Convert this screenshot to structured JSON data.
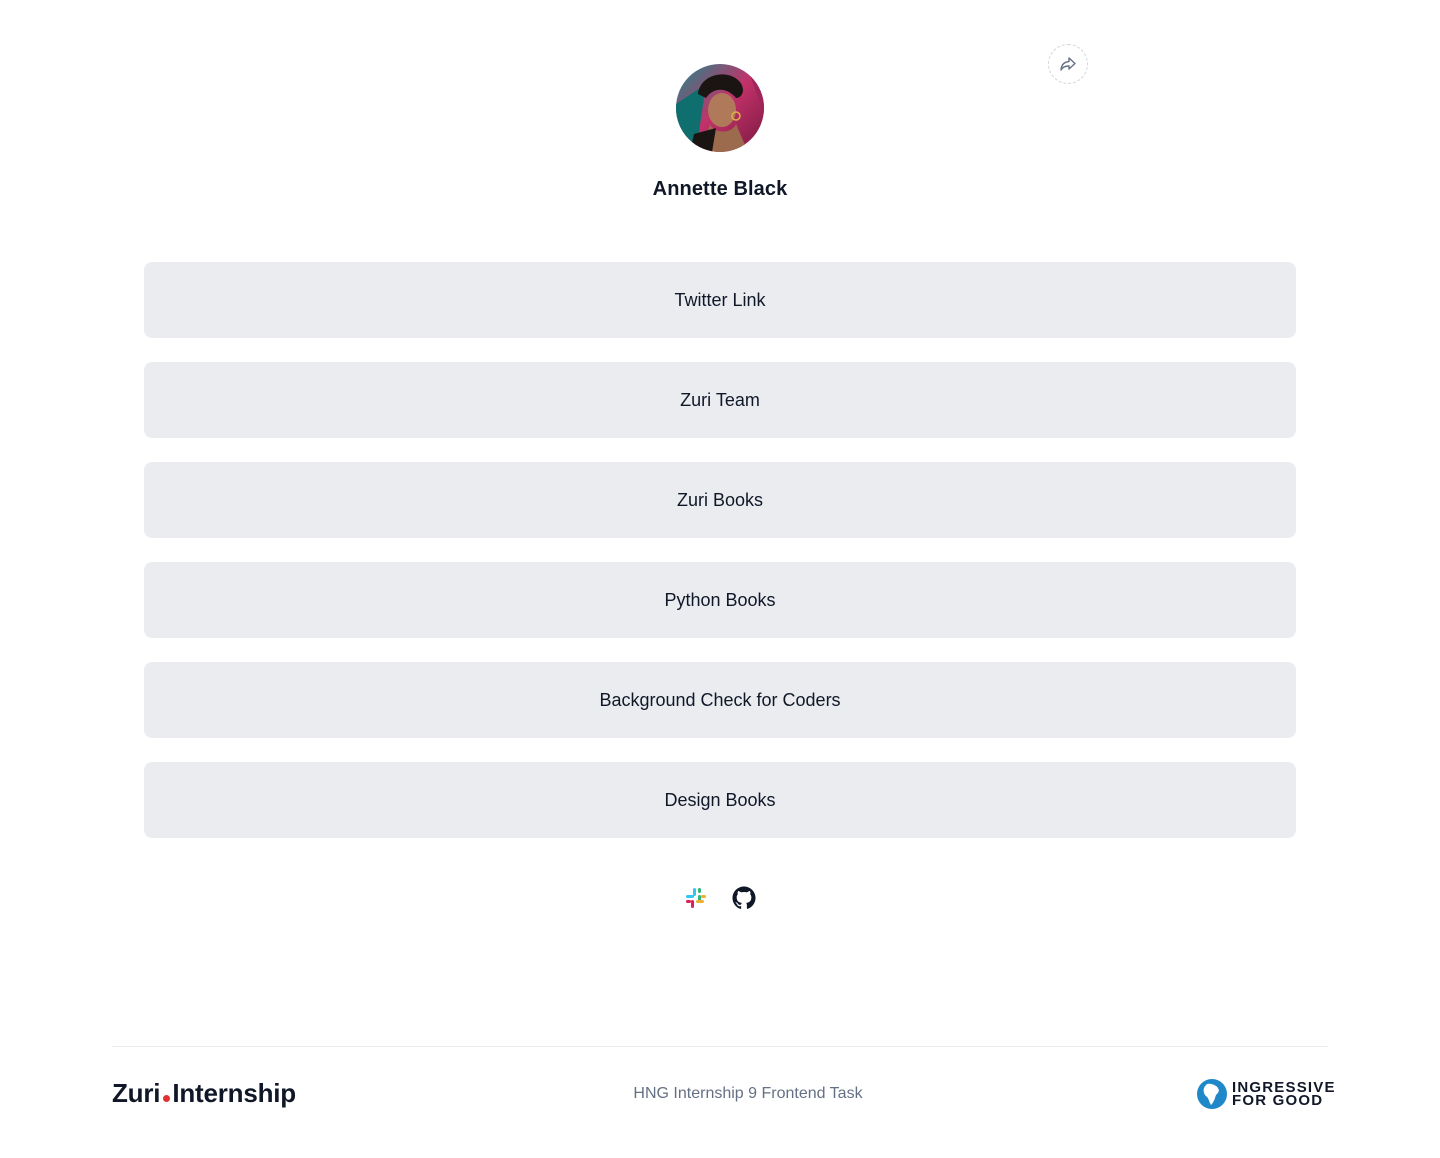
{
  "profile": {
    "name": "Annette Black",
    "avatar_alt": "profile picture"
  },
  "share": {
    "icon": "share-icon"
  },
  "links": [
    {
      "label": "Twitter Link"
    },
    {
      "label": "Zuri Team"
    },
    {
      "label": "Zuri Books"
    },
    {
      "label": "Python Books"
    },
    {
      "label": "Background Check for Coders"
    },
    {
      "label": "Design Books"
    }
  ],
  "socials": [
    {
      "icon": "slack-icon"
    },
    {
      "icon": "github-icon"
    }
  ],
  "footer": {
    "logo_left": "Zuri",
    "logo_right": "Internship",
    "task_text": "HNG Internship 9 Frontend Task",
    "partner_line1": "INGRESSIVE",
    "partner_line2": "FOR GOOD"
  },
  "colors": {
    "button_bg": "#eaecf0",
    "text": "#101828",
    "muted": "#667085",
    "accent_dot": "#e03131",
    "ingressive_blue": "#1e88c8"
  }
}
